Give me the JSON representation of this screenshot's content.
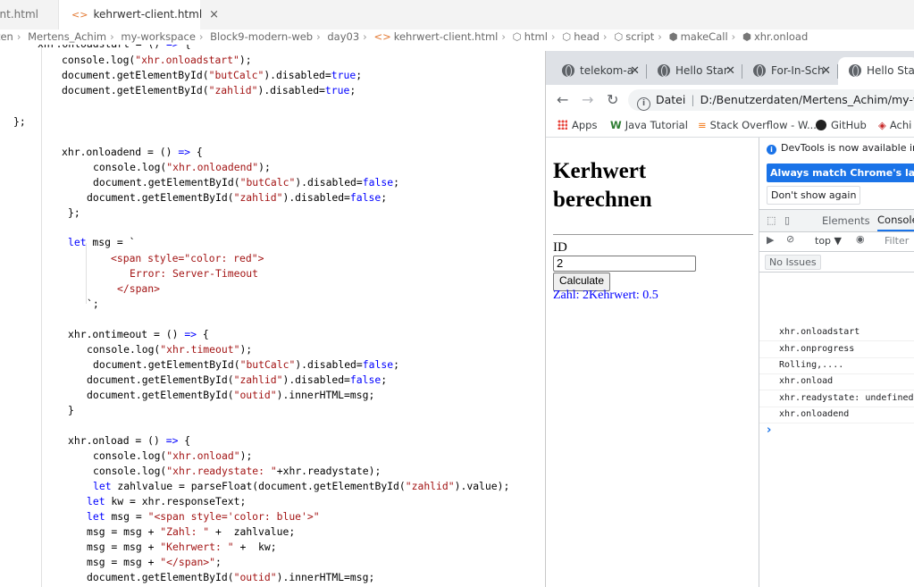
{
  "editor": {
    "tabs": [
      {
        "label": "ent.html"
      },
      {
        "label": "kehrwert-client.html",
        "close": "×"
      }
    ],
    "breadcrumb": [
      "erdaten",
      "Mertens_Achim",
      "my-workspace",
      "Block9-modern-web",
      "day03",
      "kehrwert-client.html",
      "html",
      "head",
      "script",
      "makeCall",
      "xhr.onload"
    ],
    "code_lines": [
      "xhr.onloadstart = () => {",
      "console.log(\"xhr.onloadstart\");",
      "document.getElementById(\"butCalc\").disabled=true;",
      "document.getElementById(\"zahlid\").disabled=true;",
      "};",
      "xhr.onloadend = () => {",
      "console.log(\"xhr.onloadend\");",
      "document.getElementById(\"butCalc\").disabled=false;",
      "document.getElementById(\"zahlid\").disabled=false;",
      "};",
      "let msg = `",
      "<span style=\"color: red\">",
      "Error: Server-Timeout",
      "</span>",
      "`;",
      "xhr.ontimeout = () => {",
      "console.log(\"xhr.timeout\");",
      "document.getElementById(\"butCalc\").disabled=false;",
      "document.getElementById(\"zahlid\").disabled=false;",
      "document.getElementById(\"outid\").innerHTML=msg;",
      "}",
      "xhr.onload = () => {",
      "console.log(\"xhr.onload\");",
      "console.log(\"xhr.readystate: \"+xhr.readystate);",
      "let zahlvalue = parseFloat(document.getElementById(\"zahlid\").value);",
      "let kw = xhr.responseText;",
      "let msg = \"<span style='color: blue'>\"",
      "msg = msg + \"Zahl: \" +  zahlvalue;",
      "msg = msg + \"Kehrwert: \" +  kw;",
      "msg = msg + \"</span>\";",
      "document.getElementById(\"outid\").innerHTML=msg;"
    ]
  },
  "browser": {
    "tabs": [
      {
        "label": "telekom-a"
      },
      {
        "label": "Hello Star"
      },
      {
        "label": "For-In-Sch"
      },
      {
        "label": "Hello Star"
      }
    ],
    "address": {
      "prefix": "Datei",
      "url": "D:/Benutzerdaten/Mertens_Achim/my-workspace"
    },
    "bookmarks": [
      "Apps",
      "Java Tutorial",
      "Stack Overflow - W...",
      "GitHub",
      "Achi"
    ],
    "page": {
      "title": "Kerhwert berechnen",
      "id_label": "ID",
      "input_value": "2",
      "button_label": "Calculate",
      "output": "Zahl: 2Kehrwert: 0.5"
    },
    "devtools": {
      "info_text": "DevTools is now available in Ge",
      "match_button": "Always match Chrome's language",
      "dont_show": "Don't show again",
      "tabs": [
        "Elements",
        "Console"
      ],
      "context": "top ▼",
      "filter_placeholder": "Filter",
      "issues": "No Issues",
      "console_lines": [
        "xhr.onloadstart",
        "xhr.onprogress",
        "Rolling,....",
        "xhr.onload",
        "xhr.readystate: undefined",
        "xhr.onloadend"
      ],
      "prompt": "›"
    }
  },
  "colors": {
    "keyword": "#0000ff",
    "string": "#a31515",
    "output_text": "#0000ff",
    "devtools_accent": "#1a73e8"
  }
}
